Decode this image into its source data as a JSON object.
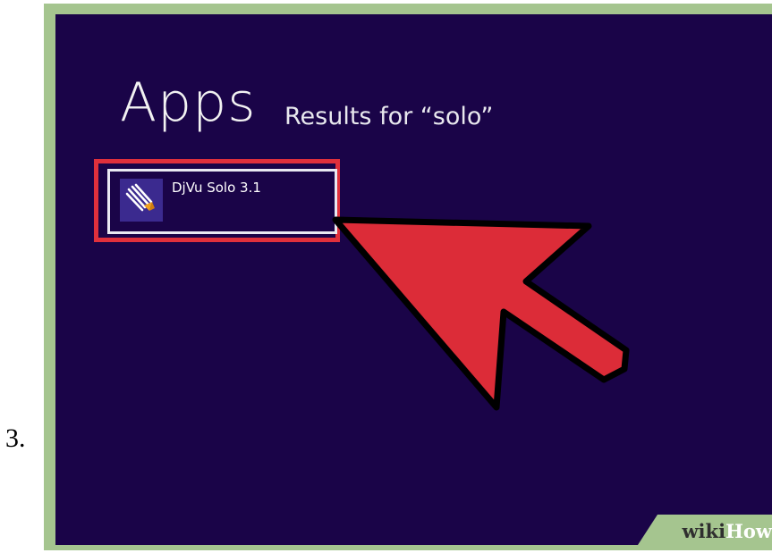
{
  "step": {
    "number": "3."
  },
  "screen": {
    "heading": "Apps",
    "results_label": "Results for “solo”",
    "background_color": "#1a0448"
  },
  "app_result": {
    "label": "DjVu Solo 3.1",
    "icon": "djvu-solo-icon",
    "highlight_color": "#e0303c"
  },
  "pointer": {
    "icon": "pointer-arrow-icon",
    "color": "#dc2c38"
  },
  "watermark": {
    "wiki": "wiki",
    "how": "How"
  }
}
